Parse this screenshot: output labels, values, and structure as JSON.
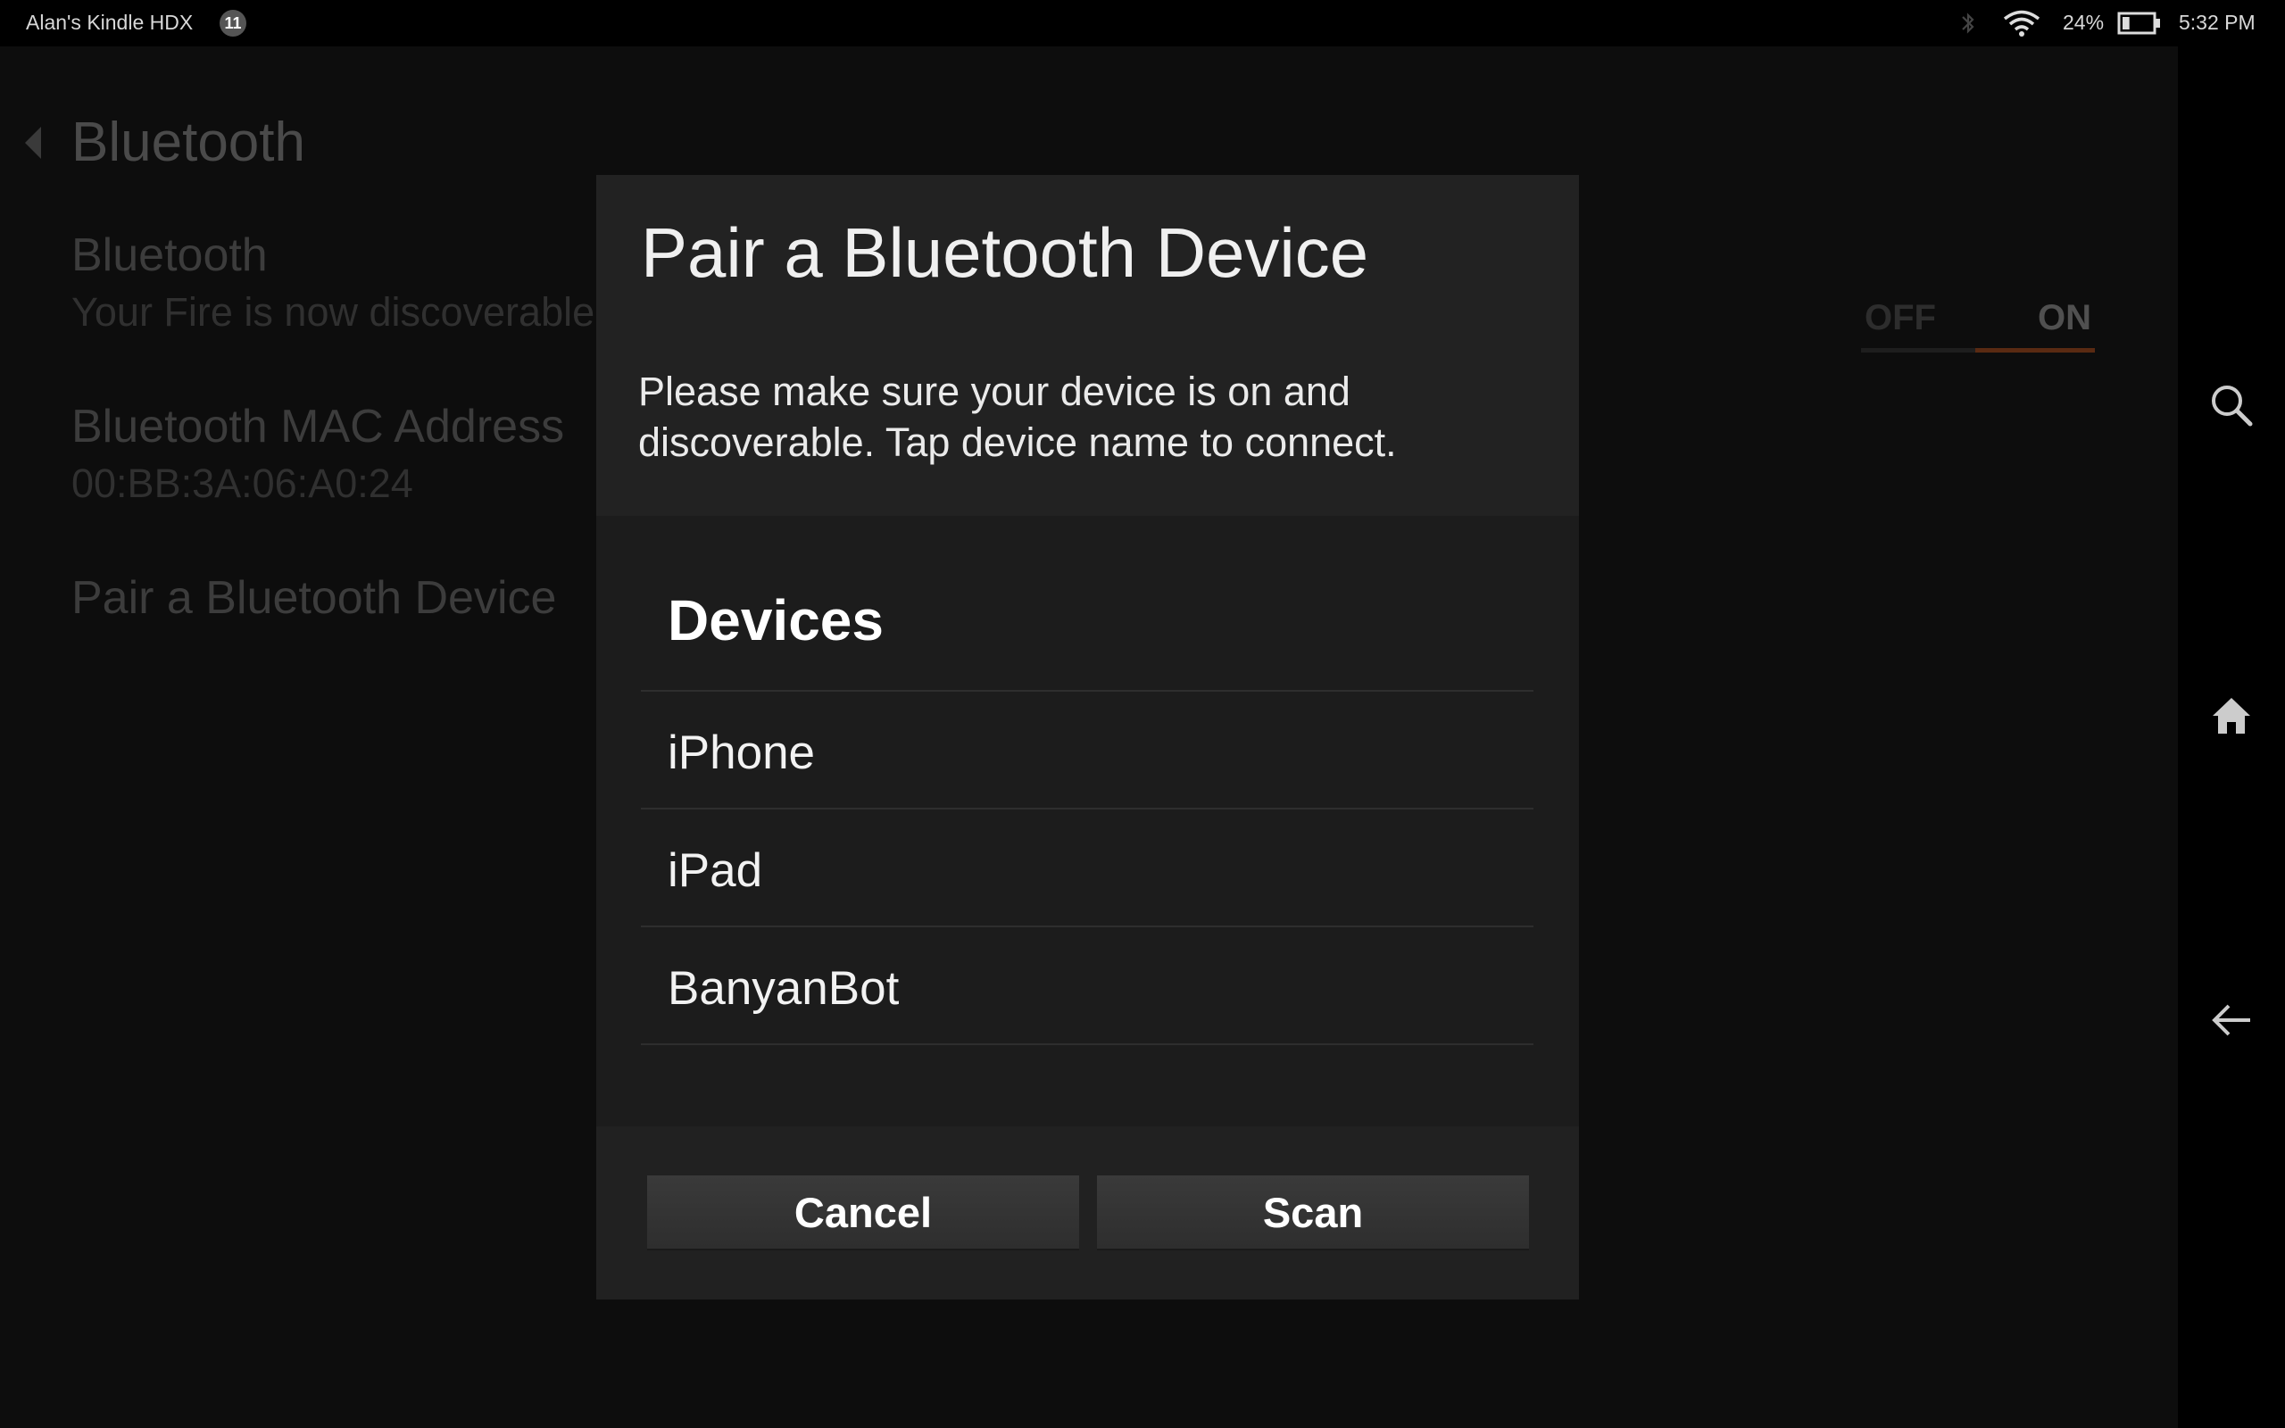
{
  "status_bar": {
    "device_name": "Alan's Kindle HDX",
    "notification_count": "11",
    "battery_percent": "24%",
    "battery_level": 0.24,
    "time": "5:32 PM",
    "icons": [
      "bluetooth-icon",
      "wifi-icon",
      "battery-icon"
    ]
  },
  "page": {
    "title": "Bluetooth",
    "settings": [
      {
        "title": "Bluetooth",
        "subtitle": "Your Fire is now discoverable"
      },
      {
        "title": "Bluetooth MAC Address",
        "subtitle": "00:BB:3A:06:A0:24"
      },
      {
        "title": "Pair a Bluetooth Device",
        "subtitle": ""
      }
    ],
    "toggle": {
      "off_label": "OFF",
      "on_label": "ON",
      "state": "ON",
      "accent": "#e8641c"
    }
  },
  "dialog": {
    "title": "Pair a Bluetooth Device",
    "message": "Please make sure your device is on and discoverable. Tap device name to connect.",
    "devices_heading": "Devices",
    "devices": [
      "iPhone",
      "iPad",
      "BanyanBot"
    ],
    "cancel_label": "Cancel",
    "scan_label": "Scan"
  },
  "nav": {
    "icons": [
      "search-icon",
      "home-icon",
      "back-icon"
    ]
  }
}
